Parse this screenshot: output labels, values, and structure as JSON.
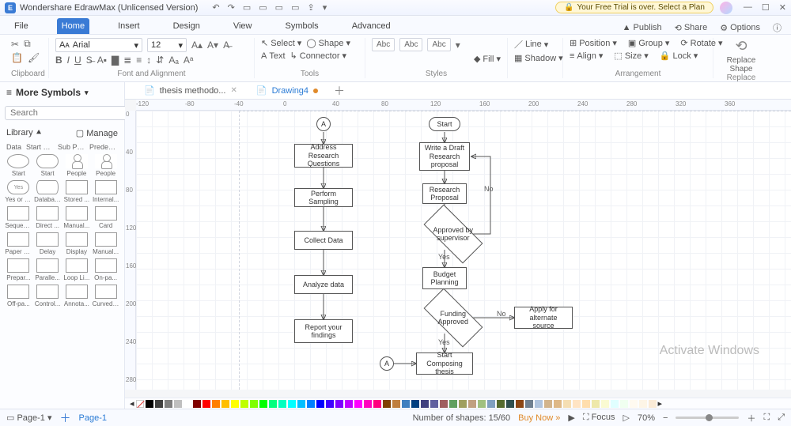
{
  "titlebar": {
    "app_name": "Wondershare EdrawMax (Unlicensed Version)",
    "trial_text": "Your Free Trial is over. Select a Plan"
  },
  "menu": {
    "file": "File",
    "home": "Home",
    "insert": "Insert",
    "design": "Design",
    "view": "View",
    "symbols": "Symbols",
    "advanced": "Advanced",
    "publish": "Publish",
    "share": "Share",
    "options": "Options"
  },
  "ribbon": {
    "clipboard": "Clipboard",
    "font_name": "Arial",
    "font_size": "12",
    "font_align": "Font and Alignment",
    "select": "Select",
    "shape": "Shape",
    "text": "Text",
    "connector": "Connector",
    "tools": "Tools",
    "abc": "Abc",
    "fill": "Fill",
    "line": "Line",
    "shadow": "Shadow",
    "styles": "Styles",
    "position": "Position",
    "group": "Group",
    "rotate": "Rotate",
    "align": "Align",
    "size": "Size",
    "lock": "Lock",
    "arrangement": "Arrangement",
    "replace_shape": "Replace Shape",
    "replace": "Replace"
  },
  "doctabs": {
    "t1": "thesis methodo...",
    "t2": "Drawing4"
  },
  "left": {
    "more_symbols": "More Symbols",
    "search_ph": "Search",
    "search_btn": "Search",
    "library": "Library",
    "manage": "Manage",
    "cats": [
      "Data",
      "Start or...",
      "Sub Pro...",
      "Predefi..."
    ],
    "shapes": [
      "Start",
      "Start",
      "People",
      "People",
      "Yes or No",
      "Database",
      "Stored ...",
      "Internal...",
      "Sequen...",
      "Direct ...",
      "Manual...",
      "Card",
      "Paper T...",
      "Delay",
      "Display",
      "Manual...",
      "Prepar...",
      "Paralle...",
      "Loop Li...",
      "On-pa...",
      "Off-pa...",
      "Control...",
      "Annota...",
      "Curved ..."
    ]
  },
  "flow": {
    "a1": "A",
    "a2": "A",
    "start": "Start",
    "addr": "Address Research Questions",
    "sampling": "Perform Sampling",
    "collect": "Collect Data",
    "analyze": "Analyze data",
    "report": "Report your findings",
    "draft": "Write a Draft Research proposal",
    "proposal": "Research Proposal",
    "approved_sup": "Approved by supervisor",
    "budget": "Budget Planning",
    "funding": "Funding Approved",
    "alt": "Apply for alternate source",
    "compose": "Start Composing thesis",
    "yes": "Yes",
    "no": "No"
  },
  "ruler_h": [
    "-120",
    "-80",
    "-40",
    "0",
    "40",
    "80",
    "120",
    "160",
    "200",
    "240",
    "280",
    "320",
    "360"
  ],
  "ruler_v": [
    "0",
    "40",
    "80",
    "120",
    "160",
    "200",
    "240",
    "280"
  ],
  "swatches": [
    "#000000",
    "#3f3f3f",
    "#7f7f7f",
    "#bfbfbf",
    "#ffffff",
    "#7f0000",
    "#ff0000",
    "#ff7f00",
    "#ffbf00",
    "#ffff00",
    "#bfff00",
    "#7fff00",
    "#00ff00",
    "#00ff7f",
    "#00ffbf",
    "#00ffff",
    "#00bfff",
    "#007fff",
    "#0000ff",
    "#3f00ff",
    "#7f00ff",
    "#bf00ff",
    "#ff00ff",
    "#ff00bf",
    "#ff007f",
    "#7f3f00",
    "#bf7f3f",
    "#3f7fbf",
    "#003f7f",
    "#3f3f7f",
    "#5f5f9f",
    "#9f5f5f",
    "#5f9f5f",
    "#9f9f5f",
    "#c0a080",
    "#a0c080",
    "#80a0c0",
    "#556b2f",
    "#2f4f4f",
    "#8b4513",
    "#708090",
    "#b0c4de",
    "#d2b48c",
    "#deb887",
    "#f5deb3",
    "#ffe4c4",
    "#ffdead",
    "#eee8aa",
    "#fafad2",
    "#e0ffff",
    "#f0fff0",
    "#fffaf0",
    "#fdf5e6",
    "#faebd7"
  ],
  "status": {
    "page_label": "Page-1",
    "page_link": "Page-1",
    "shapes": "Number of shapes: 15/60",
    "buy": "Buy Now",
    "focus": "Focus",
    "zoom": "70%"
  },
  "watermark": "Activate Windows"
}
